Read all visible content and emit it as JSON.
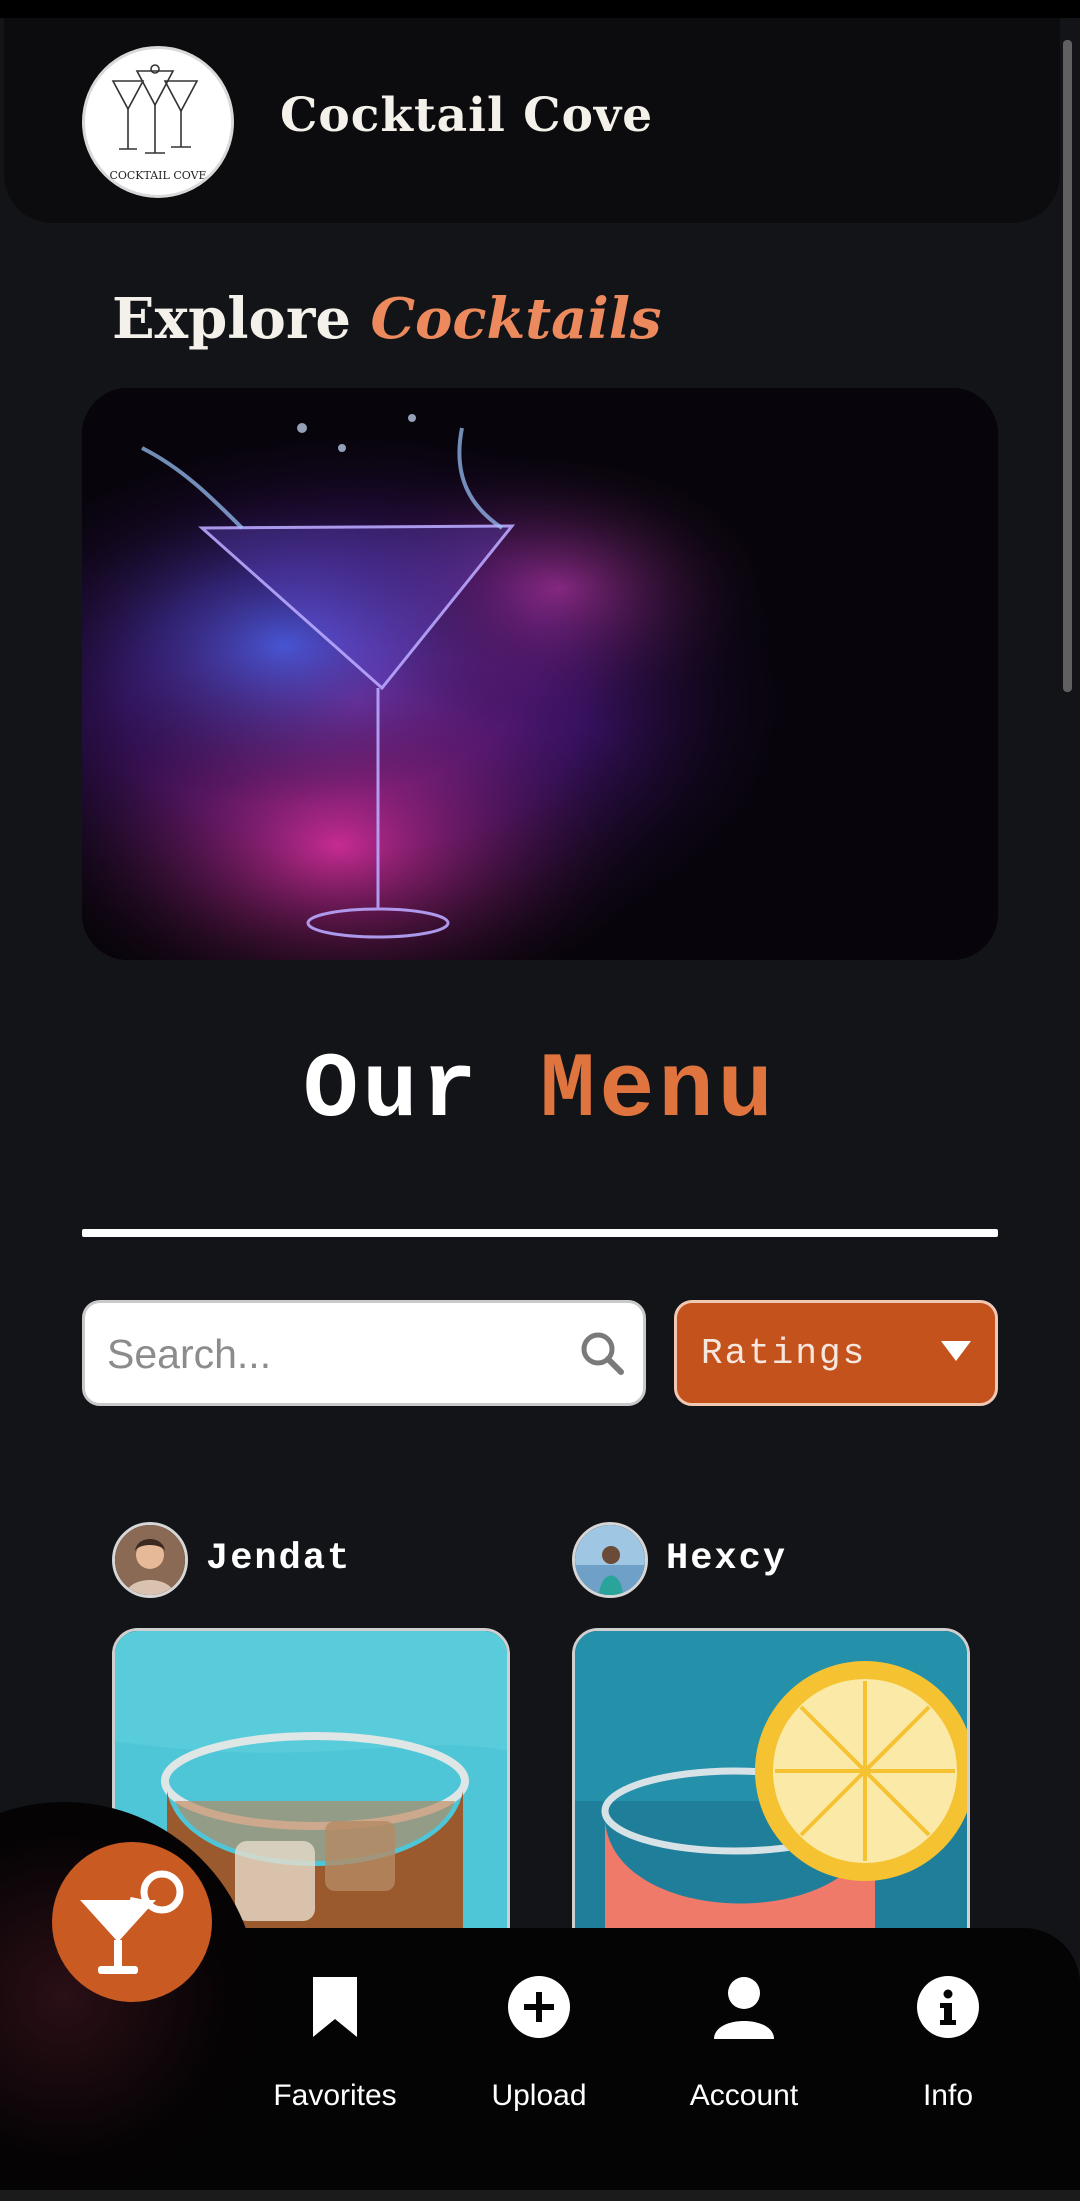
{
  "app": {
    "title": "Cocktail Cove",
    "logo_text": "COCKTAIL COVE"
  },
  "hero": {
    "heading_main": "Explore",
    "heading_accent": "Cocktails",
    "image_desc": "martini-glass-with-neon-smoke"
  },
  "menu": {
    "title_word1": "Our",
    "title_word2": "Menu"
  },
  "search": {
    "placeholder": "Search..."
  },
  "filter": {
    "selected": "Ratings"
  },
  "posts": [
    {
      "username": "Jendat"
    },
    {
      "username": "Hexcy"
    }
  ],
  "nav": [
    {
      "label": "Favorites",
      "icon": "bookmark-icon"
    },
    {
      "label": "Upload",
      "icon": "plus-circle-icon"
    },
    {
      "label": "Account",
      "icon": "user-icon"
    },
    {
      "label": "Info",
      "icon": "info-icon"
    }
  ],
  "colors": {
    "background": "#131418",
    "accent": "#e0743f",
    "accent_light": "#ec8a5e",
    "button": "#c4521c"
  }
}
